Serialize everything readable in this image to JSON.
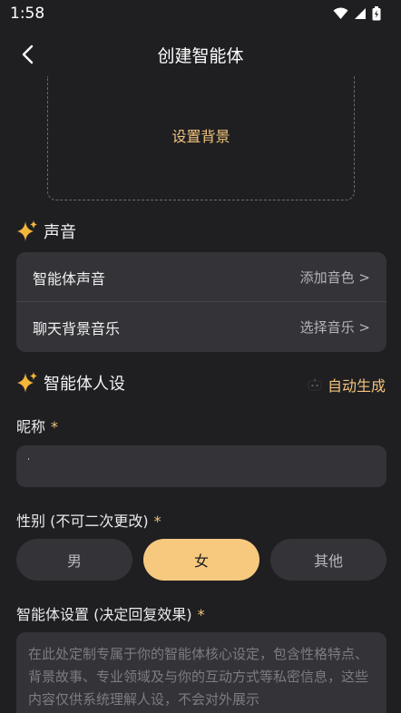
{
  "status": {
    "time": "1:58"
  },
  "header": {
    "title": "创建智能体"
  },
  "background_box": {
    "label": "设置背景"
  },
  "sound_section": {
    "title": "声音",
    "rows": [
      {
        "label": "智能体声音",
        "action": "添加音色 >"
      },
      {
        "label": "聊天背景音乐",
        "action": "选择音乐 >"
      }
    ]
  },
  "persona_section": {
    "title": "智能体人设",
    "auto_generate": "自动生成"
  },
  "nickname": {
    "label": "昵称",
    "required": "*",
    "value": ""
  },
  "gender": {
    "label": "性别 (不可二次更改)",
    "required": "*",
    "options": [
      "男",
      "女",
      "其他"
    ],
    "selected": "女"
  },
  "agent_settings": {
    "label": "智能体设置 (决定回复效果)",
    "required": "*",
    "placeholder": "在此处定制专属于你的智能体核心设定，包含性格特点、背景故事、专业领域及与你的互动方式等私密信息，这些内容仅供系统理解人设，不会对外展示"
  },
  "colors": {
    "accent": "#f3c47a",
    "selected_bg": "#f6c97f",
    "card_bg": "#333338",
    "page_bg": "#1f1f22"
  },
  "icons": [
    "wifi-icon",
    "signal-icon",
    "battery-icon",
    "back-arrow-icon",
    "sparkle-icon",
    "robot-icon"
  ]
}
